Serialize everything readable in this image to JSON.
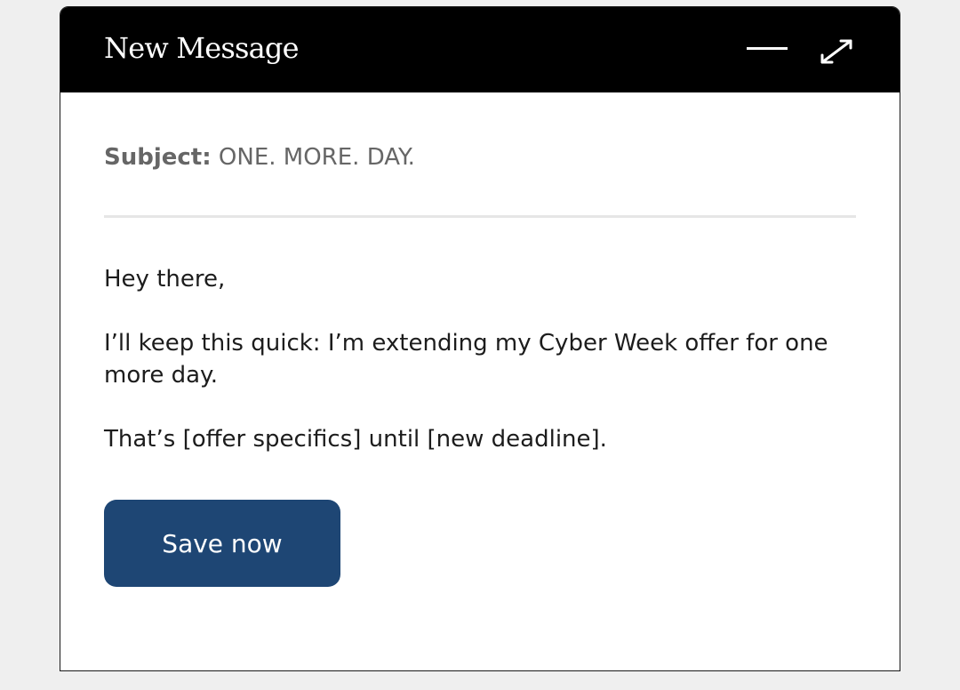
{
  "window": {
    "title": "New Message",
    "controls": {
      "minimize_icon": "minimize-icon",
      "expand_icon": "expand-icon"
    }
  },
  "subject": {
    "label": "Subject:",
    "value": "ONE. MORE. DAY."
  },
  "message": {
    "greeting": "Hey there,",
    "paragraph_1": "I’ll keep this quick: I’m extending my Cyber Week offer for one more day.",
    "paragraph_2": "That’s [offer specifics] until [new deadline]."
  },
  "cta": {
    "label": "Save now"
  },
  "colors": {
    "titlebar": "#000000",
    "cta_background": "#1e4674",
    "page_background": "#efefef"
  }
}
